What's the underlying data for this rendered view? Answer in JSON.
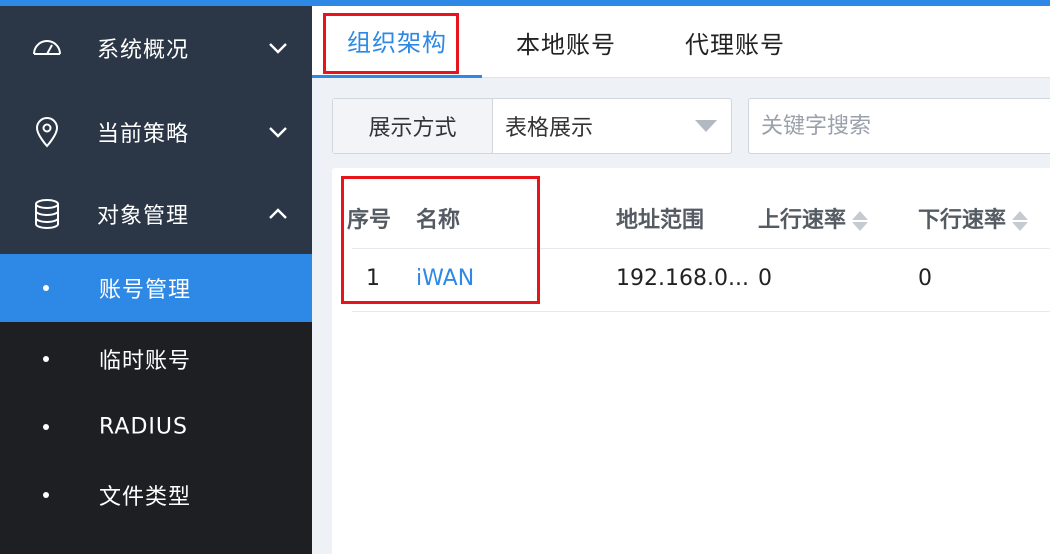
{
  "colors": {
    "accent": "#2d89e5",
    "sidebar_group_bg": "#2b3646",
    "sidebar_bg": "#1d1f22",
    "highlight": "#e8141c"
  },
  "sidebar": {
    "groups": [
      {
        "label": "系统概况",
        "icon": "dashboard-gauge-icon",
        "chevron": "chevron-down-icon"
      },
      {
        "label": "当前策略",
        "icon": "location-pin-icon",
        "chevron": "chevron-down-icon"
      },
      {
        "label": "对象管理",
        "icon": "database-icon",
        "chevron": "chevron-up-icon"
      }
    ],
    "sub_items": [
      {
        "label": "账号管理",
        "active": true
      },
      {
        "label": "临时账号",
        "active": false
      },
      {
        "label": "RADIUS",
        "active": false
      },
      {
        "label": "文件类型",
        "active": false
      }
    ]
  },
  "tabs": [
    {
      "label": "组织架构",
      "active": true
    },
    {
      "label": "本地账号",
      "active": false
    },
    {
      "label": "代理账号",
      "active": false
    }
  ],
  "toolbar": {
    "display_mode_label": "展示方式",
    "display_mode_value": "表格展示",
    "search_placeholder": "关键字搜索"
  },
  "table": {
    "headers": {
      "index": "序号",
      "name": "名称",
      "address": "地址范围",
      "up_rate": "上行速率",
      "down_rate": "下行速率"
    },
    "rows": [
      {
        "index": "1",
        "name": "iWAN",
        "address": "192.168.0...",
        "up_rate": "0",
        "down_rate": "0"
      }
    ]
  }
}
